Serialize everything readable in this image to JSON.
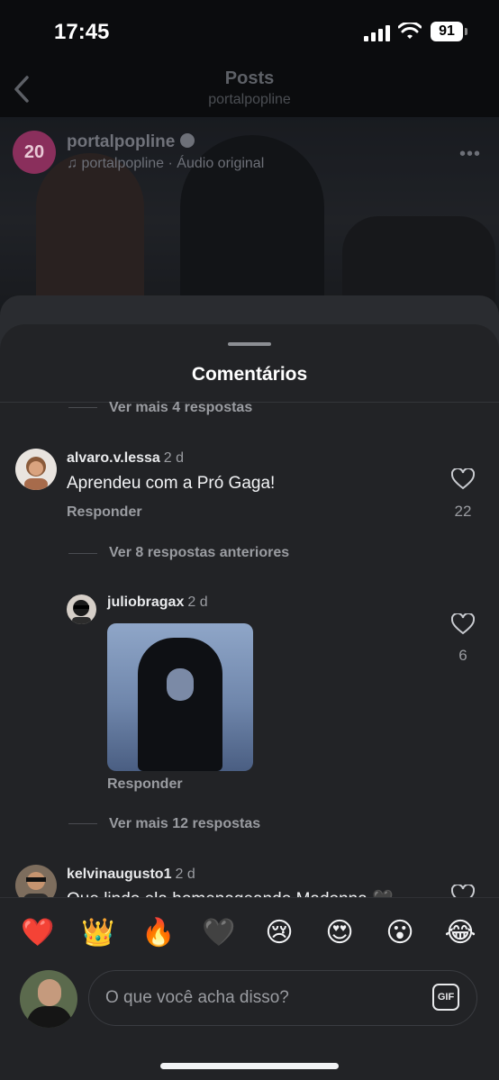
{
  "status_bar": {
    "time": "17:45",
    "battery": "91"
  },
  "header": {
    "title": "Posts",
    "subtitle": "portalpopline"
  },
  "post": {
    "avatar_text": "20",
    "username": "portalpopline",
    "audio": "portalpopline · Áudio original"
  },
  "sheet": {
    "title": "Comentários"
  },
  "thread": {
    "more_replies_top": "Ver mais 4 respostas",
    "comment1": {
      "username": "alvaro.v.lessa",
      "time": "2 d",
      "text": "Aprendeu com a Pró Gaga!",
      "reply_label": "Responder",
      "likes": "22"
    },
    "previous_replies": "Ver 8 respostas anteriores",
    "reply1": {
      "username": "juliobragax",
      "time": "2 d",
      "reply_label": "Responder",
      "likes": "6"
    },
    "more_replies_bottom": "Ver mais 12 respostas",
    "comment2": {
      "username": "kelvinaugusto1",
      "time": "2 d",
      "text": "Que lindo ela homenageando Madonna 🖤"
    }
  },
  "emojis": [
    "❤️",
    "👑",
    "🔥",
    "🖤",
    "😢",
    "😍",
    "😮",
    "😂"
  ],
  "composer": {
    "placeholder": "O que você acha disso?",
    "gif_label": "GIF"
  },
  "colors": {
    "sheet_bg": "#222326",
    "muted_text": "#9a9ca1",
    "page_bg": "#0b0c0e"
  }
}
